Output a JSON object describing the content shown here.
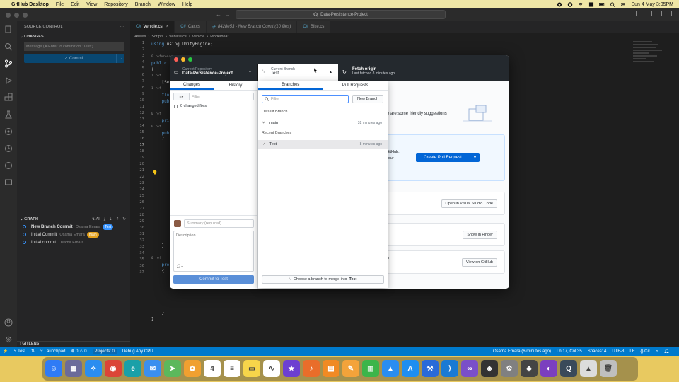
{
  "menubar": {
    "app": "GitHub Desktop",
    "items": [
      "File",
      "Edit",
      "View",
      "Repository",
      "Branch",
      "Window",
      "Help"
    ],
    "clock": "Sun 4 May  3:05PM"
  },
  "vscode": {
    "search": "Data-Persistence-Project",
    "sidebar": {
      "title": "SOURCE CONTROL",
      "changes_header": "CHANGES",
      "message_placeholder": "Message (⌘Enter to commit on \"Test\")",
      "commit_label": "✓ Commit",
      "graph_header": "GRAPH",
      "graph_tools": "↯ All",
      "graph_rows": [
        {
          "msg": "New Branch Commit",
          "author": "Osama Emara",
          "tag": "Test",
          "tag_color": "#3794ff"
        },
        {
          "msg": "Initial Commit",
          "author": "Osama Emara",
          "tag": "main",
          "tag_color": "#e5a21d"
        },
        {
          "msg": "Initial commit",
          "author": "Osama Emara",
          "tag": "",
          "tag_color": ""
        }
      ],
      "gitlens": "GITLENS"
    },
    "tabs": [
      {
        "label": "Vehicle.cs",
        "active": true
      },
      {
        "label": "Car.cs",
        "active": false
      },
      {
        "label": "8428e53 - New Branch Comit (10 files)",
        "active": false
      },
      {
        "label": "Bike.cs",
        "active": false
      }
    ],
    "breadcrumbs": [
      "Assets",
      "Scripts",
      "Vehicle.cs",
      "Vehicle",
      "ModelYear"
    ],
    "line_numbers": [
      "1",
      "2",
      "3",
      "4",
      "5",
      "6",
      "7",
      "8",
      "9",
      "10",
      "11",
      "12",
      "13",
      "14",
      "15",
      "16",
      "17",
      "18",
      "19",
      "20",
      "21",
      "22",
      "23",
      "24",
      "25",
      "26",
      "27",
      "28",
      "29",
      "30",
      "31",
      "32",
      "33",
      "34",
      "35",
      "36",
      "37"
    ],
    "code": {
      "line1": "using UnityEngine;",
      "line4_frag": "public",
      "line5_frag": "{",
      "ref0": "0 references",
      "frag_se": "[Se",
      "frag_fl": "flo",
      "frag_pub1": "pub",
      "frag_pri": "pri",
      "frag_pub2": "pub",
      "frag_brace": "{",
      "frag_close": "}",
      "frag_pro": "pro",
      "frag_brace2": "{",
      "frag_close2": "}",
      "frag_close3": "}",
      "ref1": "1 ref",
      "ref2": "1 ref",
      "ref3": "0 ref",
      "ref4": "0 ref",
      "ref5": "0 ref"
    },
    "statusbar": {
      "branch": "Test",
      "launchpad": "Launchpad",
      "problems": "⊗ 0 ⚠ 0",
      "projects": "Projects: 0",
      "debug": "Debug Any CPU",
      "blame": "Osama Emara (6 minutes ago)",
      "position": "Ln 17, Col 35",
      "spaces": "Spaces: 4",
      "encoding": "UTF-8",
      "eol": "LF",
      "lang": "{} C#"
    }
  },
  "github_desktop": {
    "toolbar": {
      "repo_label": "Current Repository",
      "repo_value": "Data-Persistence-Project",
      "branch_label": "Current Branch",
      "branch_value": "Test",
      "fetch_label": "Fetch origin",
      "fetch_sub": "Last fetched 8 minutes ago"
    },
    "left": {
      "tab_changes": "Changes",
      "tab_history": "History",
      "filter_placeholder": "Filter",
      "changed_files": "0 changed files",
      "summary_placeholder": "Summary (required)",
      "description_placeholder": "Description",
      "commit_button": "Commit to Test"
    },
    "right": {
      "suggest_text": "re are some friendly suggestions",
      "card1_text_a": "GitHub.",
      "card1_text_b": "your",
      "create_pr": "Create Pull Request",
      "open_vscode": "Open in Visual Studio Code",
      "show_finder": "Show in Finder",
      "view_github": "View on GitHub",
      "card4_text": "er"
    },
    "dropdown": {
      "tab_branches": "Branches",
      "tab_prs": "Pull Requests",
      "filter_placeholder": "Filter",
      "new_branch": "New Branch",
      "default_header": "Default Branch",
      "default_branch": {
        "name": "main",
        "time": "32 minutes ago"
      },
      "recent_header": "Recent Branches",
      "recent_branch": {
        "name": "Test",
        "time": "8 minutes ago"
      },
      "merge_prefix": "Choose a branch to merge into",
      "merge_target": "Test"
    }
  },
  "dock": {
    "icons": [
      {
        "name": "finder-icon",
        "color": "#2f7bf5",
        "glyph": "☺"
      },
      {
        "name": "launchpad-icon",
        "color": "#6b6b9a",
        "glyph": "▦"
      },
      {
        "name": "safari-icon",
        "color": "#2a8df0",
        "glyph": "✧"
      },
      {
        "name": "chrome-icon",
        "color": "#db4437",
        "glyph": "◉"
      },
      {
        "name": "edge-icon",
        "color": "#1aa0a8",
        "glyph": "e"
      },
      {
        "name": "mail-icon",
        "color": "#3b8fef",
        "glyph": "✉"
      },
      {
        "name": "maps-icon",
        "color": "#5cb85c",
        "glyph": "➤"
      },
      {
        "name": "photos-icon",
        "color": "#f0a030",
        "glyph": "✿"
      },
      {
        "name": "calendar-icon",
        "color": "#ffffff",
        "glyph": "4"
      },
      {
        "name": "reminders-icon",
        "color": "#ffffff",
        "glyph": "≡"
      },
      {
        "name": "notes-icon",
        "color": "#f7d54a",
        "glyph": "▭"
      },
      {
        "name": "freeform-icon",
        "color": "#ffffff",
        "glyph": "∿"
      },
      {
        "name": "imovie-icon",
        "color": "#6c3fd1",
        "glyph": "★"
      },
      {
        "name": "garageband-icon",
        "color": "#e96d2a",
        "glyph": "♪"
      },
      {
        "name": "books-icon",
        "color": "#f08a24",
        "glyph": "▤"
      },
      {
        "name": "pages-icon",
        "color": "#f3a33a",
        "glyph": "✎"
      },
      {
        "name": "numbers-icon",
        "color": "#3cb54a",
        "glyph": "▥"
      },
      {
        "name": "keynote-icon",
        "color": "#2a8df0",
        "glyph": "▲"
      },
      {
        "name": "appstore-icon",
        "color": "#1e8ef0",
        "glyph": "A"
      },
      {
        "name": "xcode-icon",
        "color": "#2a6ad8",
        "glyph": "⚒"
      },
      {
        "name": "vscode-icon",
        "color": "#1a7ad4",
        "glyph": "⟩"
      },
      {
        "name": "visualstudio-icon",
        "color": "#7a4fc9",
        "glyph": "∞"
      },
      {
        "name": "unity-icon",
        "color": "#333333",
        "glyph": "◈"
      },
      {
        "name": "settings-icon",
        "color": "#808080",
        "glyph": "⚙"
      },
      {
        "name": "unityhub-icon",
        "color": "#444444",
        "glyph": "◈"
      },
      {
        "name": "github-desktop-icon",
        "color": "#7b3fbf",
        "glyph": "◐"
      },
      {
        "name": "quicktime-icon",
        "color": "#3a4a5a",
        "glyph": "Q"
      },
      {
        "name": "preview-icon",
        "color": "#dcdcdc",
        "glyph": "▲"
      },
      {
        "name": "trash-icon",
        "color": "#bfbfbf",
        "glyph": "🗑"
      }
    ]
  }
}
